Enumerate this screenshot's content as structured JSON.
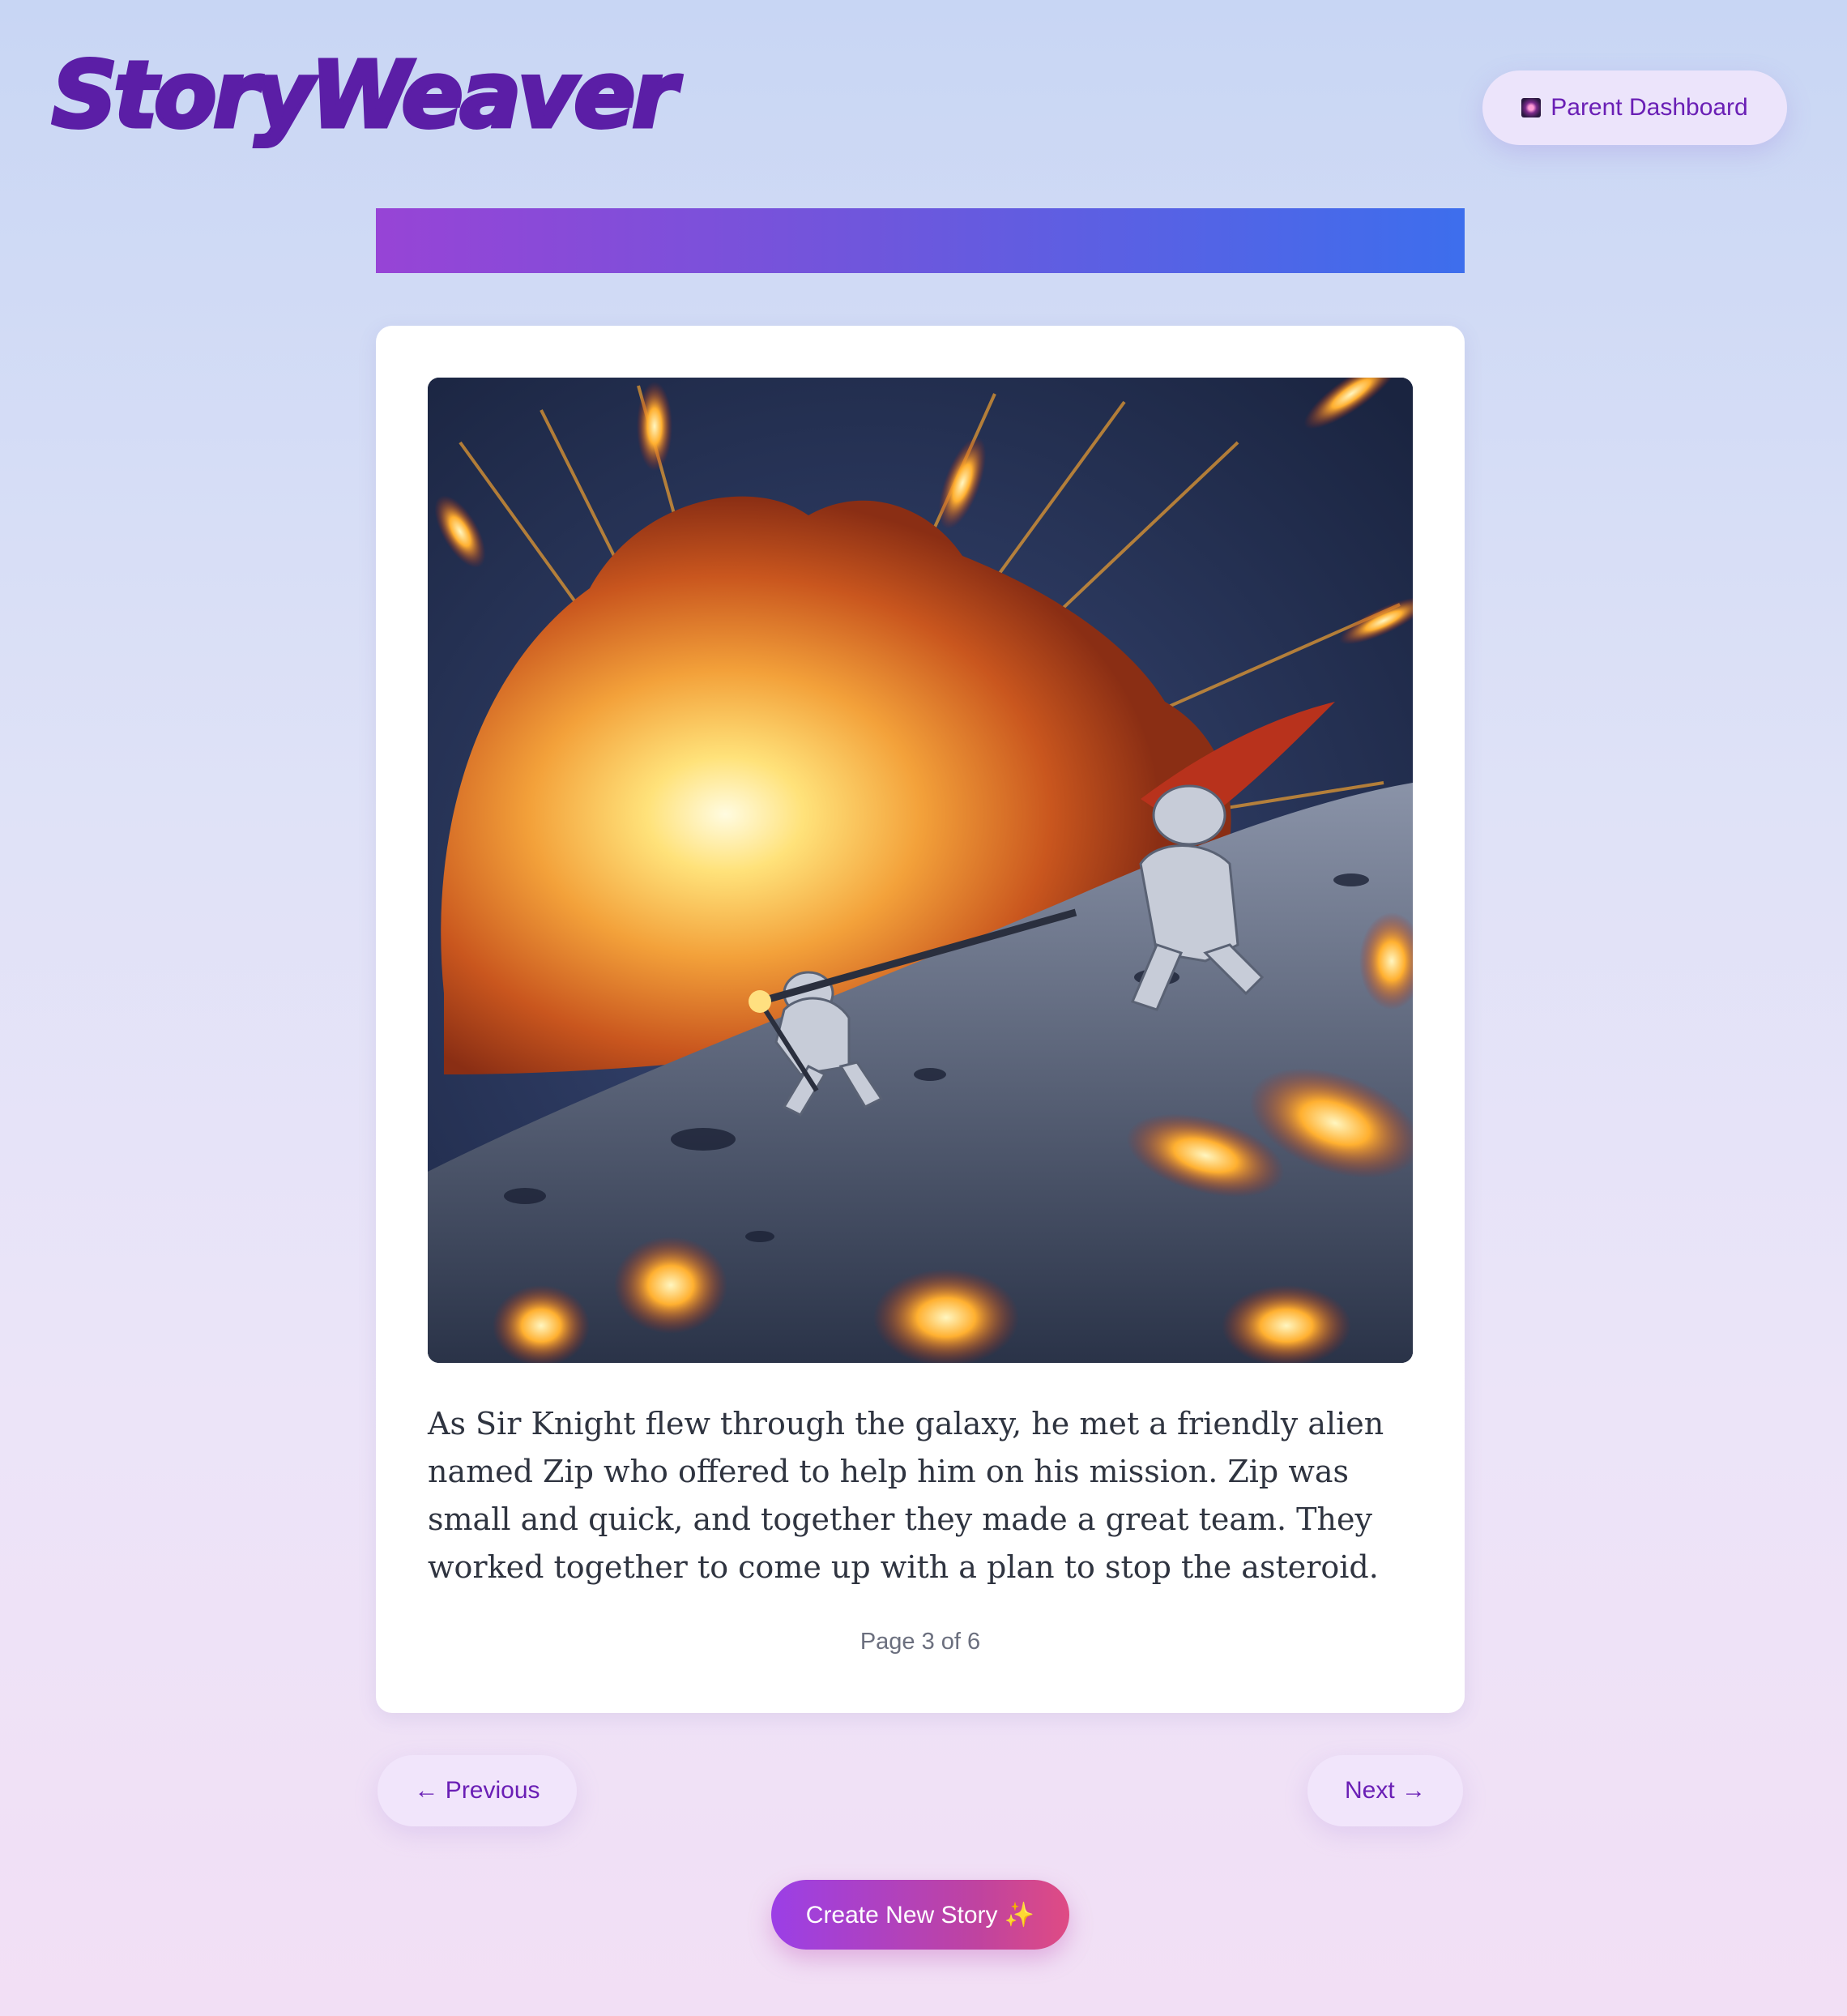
{
  "header": {
    "logo": "StoryWeaver",
    "dashboard_icon": "sparkle-image-icon",
    "dashboard_label": "Parent Dashboard"
  },
  "progress": {
    "fraction": 1.0
  },
  "story": {
    "illustration_icon": "space-battle-illustration",
    "text": "As Sir Knight flew through the galaxy, he met a friendly alien named Zip who offered to help him on his mission. Zip was small and quick, and together they made a great team. They worked together to come up with a plan to stop the asteroid.",
    "page_indicator": "Page 3 of 6"
  },
  "nav": {
    "previous_label": "← Previous",
    "next_label": "Next →",
    "create_label": "Create New Story ✨"
  },
  "colors": {
    "brand": "#5b1ea6",
    "accent": "#6a1fb5",
    "progress_start": "#9744d6",
    "progress_end": "#3d6eed",
    "cta_start": "#9b3fe6",
    "cta_end": "#df4b84"
  }
}
